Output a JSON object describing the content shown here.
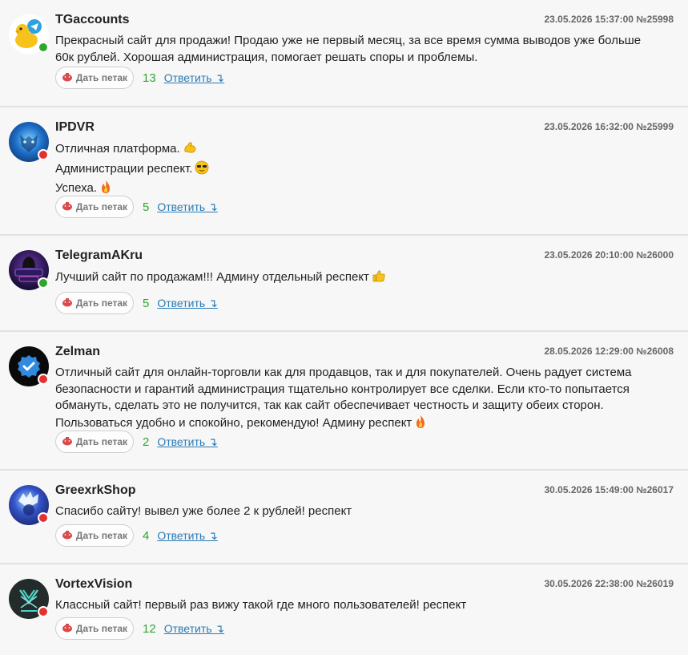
{
  "tip_label": "Дать петак",
  "reply_label": "Ответить ↴",
  "status_colors": {
    "online": "#2ea52e",
    "offline": "#e53030"
  },
  "comments": [
    {
      "username": "TGaccounts",
      "meta": "23.05.2026 15:37:00 №25998",
      "lines": [
        "Прекрасный сайт для продажи! Продаю уже не первый месяц, за все время сумма выводов уже больше",
        "60к рублей. Хорошая администрация, помогает решать споры и проблемы."
      ],
      "count": "13",
      "status": "online",
      "avatar": "duck-telegram-logo"
    },
    {
      "username": "IPDVR",
      "meta": "23.05.2026 16:32:00 №25999",
      "lines": [
        "Отличная платформа.",
        "Администрации респект.",
        "Успеха."
      ],
      "count": "5",
      "status": "offline",
      "avatar": "blue-tiger-image"
    },
    {
      "username": "TelegramAKru",
      "meta": "23.05.2026 20:10:00 №26000",
      "lines": [
        "Лучший сайт по продажам!!! Админу отдельный респект"
      ],
      "count": "5",
      "status": "online",
      "avatar": "digital-shop-logo"
    },
    {
      "username": "Zelman",
      "meta": "28.05.2026 12:29:00 №26008",
      "lines": [
        "Отличный сайт для онлайн-торговли как для продавцов, так и для покупателей. Очень радует система",
        "безопасности и гарантий администрация тщательно контролирует все сделки. Если кто-то попытается",
        "обмануть, сделать это не получится, так как сайт обеспечивает честность и защиту обеих сторон.",
        "Пользоваться удобно и спокойно, рекомендую! Админу респект"
      ],
      "count": "2",
      "status": "offline",
      "avatar": "verified-badge-logo"
    },
    {
      "username": "GreexrkShop",
      "meta": "30.05.2026 15:49:00 №26017",
      "lines": [
        "Спасибо сайту! вывел уже более 2 к рублей! респект"
      ],
      "count": "4",
      "status": "offline",
      "avatar": "anime-character-image"
    },
    {
      "username": "VortexVision",
      "meta": "30.05.2026 22:38:00 №26019",
      "lines": [
        "Классный сайт! первый раз вижу такой где много пользователей! респект"
      ],
      "count": "12",
      "status": "offline",
      "avatar": "vortex-logo"
    }
  ]
}
